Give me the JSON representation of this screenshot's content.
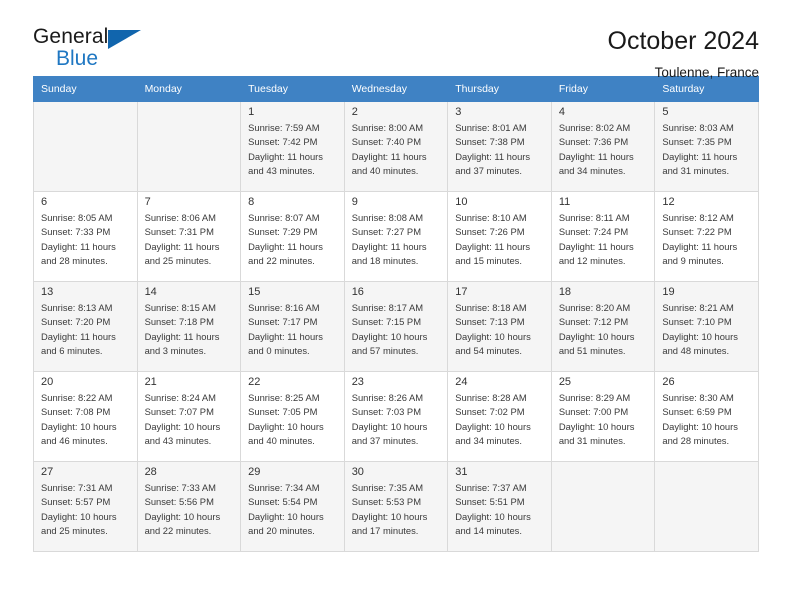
{
  "logo": {
    "primary_text": "General",
    "secondary_text": "Blue",
    "primary_color": "#1a1a1a",
    "secondary_color": "#1f77c2",
    "triangle_color": "#1165ad"
  },
  "header": {
    "title": "October 2024",
    "subtitle": "Toulenne, France"
  },
  "theme": {
    "header_row_bg": "#3f82c4",
    "header_row_text": "#ffffff",
    "shaded_row_bg": "#f5f5f5",
    "cell_border": "#d9d9d9"
  },
  "weekdays": [
    "Sunday",
    "Monday",
    "Tuesday",
    "Wednesday",
    "Thursday",
    "Friday",
    "Saturday"
  ],
  "weeks": [
    [
      {
        "day": "",
        "sunrise": "",
        "sunset": "",
        "daylight_line1": "",
        "daylight_line2": ""
      },
      {
        "day": "",
        "sunrise": "",
        "sunset": "",
        "daylight_line1": "",
        "daylight_line2": ""
      },
      {
        "day": "1",
        "sunrise": "Sunrise: 7:59 AM",
        "sunset": "Sunset: 7:42 PM",
        "daylight_line1": "Daylight: 11 hours",
        "daylight_line2": "and 43 minutes."
      },
      {
        "day": "2",
        "sunrise": "Sunrise: 8:00 AM",
        "sunset": "Sunset: 7:40 PM",
        "daylight_line1": "Daylight: 11 hours",
        "daylight_line2": "and 40 minutes."
      },
      {
        "day": "3",
        "sunrise": "Sunrise: 8:01 AM",
        "sunset": "Sunset: 7:38 PM",
        "daylight_line1": "Daylight: 11 hours",
        "daylight_line2": "and 37 minutes."
      },
      {
        "day": "4",
        "sunrise": "Sunrise: 8:02 AM",
        "sunset": "Sunset: 7:36 PM",
        "daylight_line1": "Daylight: 11 hours",
        "daylight_line2": "and 34 minutes."
      },
      {
        "day": "5",
        "sunrise": "Sunrise: 8:03 AM",
        "sunset": "Sunset: 7:35 PM",
        "daylight_line1": "Daylight: 11 hours",
        "daylight_line2": "and 31 minutes."
      }
    ],
    [
      {
        "day": "6",
        "sunrise": "Sunrise: 8:05 AM",
        "sunset": "Sunset: 7:33 PM",
        "daylight_line1": "Daylight: 11 hours",
        "daylight_line2": "and 28 minutes."
      },
      {
        "day": "7",
        "sunrise": "Sunrise: 8:06 AM",
        "sunset": "Sunset: 7:31 PM",
        "daylight_line1": "Daylight: 11 hours",
        "daylight_line2": "and 25 minutes."
      },
      {
        "day": "8",
        "sunrise": "Sunrise: 8:07 AM",
        "sunset": "Sunset: 7:29 PM",
        "daylight_line1": "Daylight: 11 hours",
        "daylight_line2": "and 22 minutes."
      },
      {
        "day": "9",
        "sunrise": "Sunrise: 8:08 AM",
        "sunset": "Sunset: 7:27 PM",
        "daylight_line1": "Daylight: 11 hours",
        "daylight_line2": "and 18 minutes."
      },
      {
        "day": "10",
        "sunrise": "Sunrise: 8:10 AM",
        "sunset": "Sunset: 7:26 PM",
        "daylight_line1": "Daylight: 11 hours",
        "daylight_line2": "and 15 minutes."
      },
      {
        "day": "11",
        "sunrise": "Sunrise: 8:11 AM",
        "sunset": "Sunset: 7:24 PM",
        "daylight_line1": "Daylight: 11 hours",
        "daylight_line2": "and 12 minutes."
      },
      {
        "day": "12",
        "sunrise": "Sunrise: 8:12 AM",
        "sunset": "Sunset: 7:22 PM",
        "daylight_line1": "Daylight: 11 hours",
        "daylight_line2": "and 9 minutes."
      }
    ],
    [
      {
        "day": "13",
        "sunrise": "Sunrise: 8:13 AM",
        "sunset": "Sunset: 7:20 PM",
        "daylight_line1": "Daylight: 11 hours",
        "daylight_line2": "and 6 minutes."
      },
      {
        "day": "14",
        "sunrise": "Sunrise: 8:15 AM",
        "sunset": "Sunset: 7:18 PM",
        "daylight_line1": "Daylight: 11 hours",
        "daylight_line2": "and 3 minutes."
      },
      {
        "day": "15",
        "sunrise": "Sunrise: 8:16 AM",
        "sunset": "Sunset: 7:17 PM",
        "daylight_line1": "Daylight: 11 hours",
        "daylight_line2": "and 0 minutes."
      },
      {
        "day": "16",
        "sunrise": "Sunrise: 8:17 AM",
        "sunset": "Sunset: 7:15 PM",
        "daylight_line1": "Daylight: 10 hours",
        "daylight_line2": "and 57 minutes."
      },
      {
        "day": "17",
        "sunrise": "Sunrise: 8:18 AM",
        "sunset": "Sunset: 7:13 PM",
        "daylight_line1": "Daylight: 10 hours",
        "daylight_line2": "and 54 minutes."
      },
      {
        "day": "18",
        "sunrise": "Sunrise: 8:20 AM",
        "sunset": "Sunset: 7:12 PM",
        "daylight_line1": "Daylight: 10 hours",
        "daylight_line2": "and 51 minutes."
      },
      {
        "day": "19",
        "sunrise": "Sunrise: 8:21 AM",
        "sunset": "Sunset: 7:10 PM",
        "daylight_line1": "Daylight: 10 hours",
        "daylight_line2": "and 48 minutes."
      }
    ],
    [
      {
        "day": "20",
        "sunrise": "Sunrise: 8:22 AM",
        "sunset": "Sunset: 7:08 PM",
        "daylight_line1": "Daylight: 10 hours",
        "daylight_line2": "and 46 minutes."
      },
      {
        "day": "21",
        "sunrise": "Sunrise: 8:24 AM",
        "sunset": "Sunset: 7:07 PM",
        "daylight_line1": "Daylight: 10 hours",
        "daylight_line2": "and 43 minutes."
      },
      {
        "day": "22",
        "sunrise": "Sunrise: 8:25 AM",
        "sunset": "Sunset: 7:05 PM",
        "daylight_line1": "Daylight: 10 hours",
        "daylight_line2": "and 40 minutes."
      },
      {
        "day": "23",
        "sunrise": "Sunrise: 8:26 AM",
        "sunset": "Sunset: 7:03 PM",
        "daylight_line1": "Daylight: 10 hours",
        "daylight_line2": "and 37 minutes."
      },
      {
        "day": "24",
        "sunrise": "Sunrise: 8:28 AM",
        "sunset": "Sunset: 7:02 PM",
        "daylight_line1": "Daylight: 10 hours",
        "daylight_line2": "and 34 minutes."
      },
      {
        "day": "25",
        "sunrise": "Sunrise: 8:29 AM",
        "sunset": "Sunset: 7:00 PM",
        "daylight_line1": "Daylight: 10 hours",
        "daylight_line2": "and 31 minutes."
      },
      {
        "day": "26",
        "sunrise": "Sunrise: 8:30 AM",
        "sunset": "Sunset: 6:59 PM",
        "daylight_line1": "Daylight: 10 hours",
        "daylight_line2": "and 28 minutes."
      }
    ],
    [
      {
        "day": "27",
        "sunrise": "Sunrise: 7:31 AM",
        "sunset": "Sunset: 5:57 PM",
        "daylight_line1": "Daylight: 10 hours",
        "daylight_line2": "and 25 minutes."
      },
      {
        "day": "28",
        "sunrise": "Sunrise: 7:33 AM",
        "sunset": "Sunset: 5:56 PM",
        "daylight_line1": "Daylight: 10 hours",
        "daylight_line2": "and 22 minutes."
      },
      {
        "day": "29",
        "sunrise": "Sunrise: 7:34 AM",
        "sunset": "Sunset: 5:54 PM",
        "daylight_line1": "Daylight: 10 hours",
        "daylight_line2": "and 20 minutes."
      },
      {
        "day": "30",
        "sunrise": "Sunrise: 7:35 AM",
        "sunset": "Sunset: 5:53 PM",
        "daylight_line1": "Daylight: 10 hours",
        "daylight_line2": "and 17 minutes."
      },
      {
        "day": "31",
        "sunrise": "Sunrise: 7:37 AM",
        "sunset": "Sunset: 5:51 PM",
        "daylight_line1": "Daylight: 10 hours",
        "daylight_line2": "and 14 minutes."
      },
      {
        "day": "",
        "sunrise": "",
        "sunset": "",
        "daylight_line1": "",
        "daylight_line2": ""
      },
      {
        "day": "",
        "sunrise": "",
        "sunset": "",
        "daylight_line1": "",
        "daylight_line2": ""
      }
    ]
  ]
}
